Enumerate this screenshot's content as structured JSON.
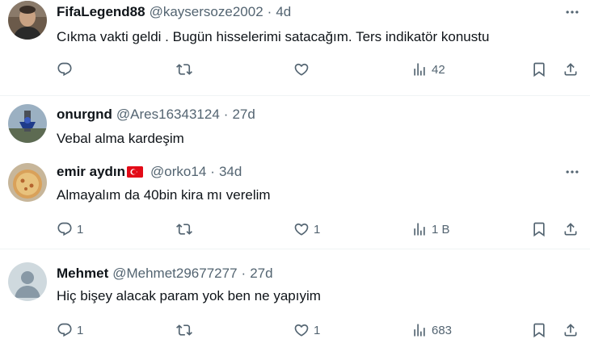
{
  "tweets": [
    {
      "name": "FifaLegend88",
      "handle": "@kaysersoze2002",
      "age": "4d",
      "text": "Cıkma vakti geldi . Bugün hisselerimi satacağım. Ters indikatör konustu",
      "replies": "",
      "retweets": "",
      "likes": "",
      "views": "42"
    },
    {
      "name": "onurgnd",
      "handle": "@Ares16343124",
      "age": "27d",
      "text": "Vebal alma kardeşim"
    },
    {
      "name": "emir aydın",
      "handle": "@orko14",
      "age": "34d",
      "text": "Almayalım da 40bin kira mı verelim",
      "replies": "1",
      "retweets": "",
      "likes": "1",
      "views": "1 B"
    },
    {
      "name": "Mehmet",
      "handle": "@Mehmet29677277",
      "age": "27d",
      "text": "Hiç bişey alacak param yok ben ne yapıyim",
      "replies": "1",
      "retweets": "",
      "likes": "1",
      "views": "683"
    }
  ],
  "separator": "·",
  "colors": {
    "text": "#0f1419",
    "secondary": "#536471",
    "divider": "#eff3f4",
    "flag_red": "#e30a17"
  },
  "icons": [
    "reply-icon",
    "retweet-icon",
    "like-icon",
    "views-icon",
    "bookmark-icon",
    "share-icon",
    "more-icon"
  ]
}
